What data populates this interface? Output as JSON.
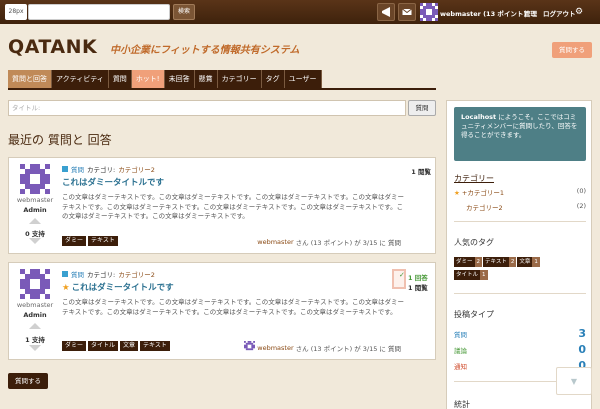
{
  "topbar": {
    "logo_text": "28px",
    "search_button": "検索",
    "user_label": "webmaster (13 ポイント)",
    "manage_label": "管理",
    "logout_label": "ログアウト",
    "settings_icon": "gear-icon"
  },
  "header": {
    "title": "QATANK",
    "tagline": "中小企業にフィットする情報共有システム",
    "ask_button": "質問する"
  },
  "nav": {
    "tabs": [
      "質問と回答",
      "アクティビティ",
      "質問",
      "ホット!",
      "未回答",
      "懸賞",
      "カテゴリー",
      "タグ",
      "ユーザー"
    ],
    "active_index": 0,
    "hot_index": 3
  },
  "search": {
    "placeholder": "タイトル:",
    "button": "質問"
  },
  "section": {
    "heading": "最近の 質問と 回答"
  },
  "questions": [
    {
      "author": "webmaster",
      "role": "Admin",
      "votes": "0 支持",
      "type": "質問",
      "category_prefix": "カテゴリ:",
      "category": "カテゴリー2",
      "title": "これはダミータイトルです",
      "starred": false,
      "body": "この文章はダミーテキストです。この文章はダミーテキストです。この文章はダミーテキストです。この文章はダミーテキストです。この文章はダミーテキストです。この文章はダミーテキストです。この文章はダミーテキストです。この文章はダミーテキストです。この文章はダミーテキストです。",
      "tags": [
        "ダミー",
        "テキスト"
      ],
      "answers": "1 閲覧",
      "footer_user": "webmaster",
      "footer_text": "さん (13 ポイント) が 3/15 に 質問"
    },
    {
      "author": "webmaster",
      "role": "Admin",
      "votes": "1 支持",
      "type": "質問",
      "category_prefix": "カテゴリ:",
      "category": "カテゴリー2",
      "title": "これはダミータイトルです",
      "starred": true,
      "body": "この文章はダミーテキストです。この文章はダミーテキストです。この文章はダミーテキストです。この文章はダミーテキストです。この文章はダミーテキストです。この文章はダミーテキストです。この文章はダミーテキストです。",
      "tags": [
        "ダミー",
        "タイトル",
        "文章",
        "テキスト"
      ],
      "answered_label": "1 回答",
      "views": "1 閲覧",
      "footer_user": "webmaster",
      "footer_text": "さん (13 ポイント) が 3/15 に 質問"
    }
  ],
  "ask_bottom": "質問する",
  "sidebar": {
    "welcome": "Localhost にようこそ。ここではコミュニティメンバーに質問したり、回答を得ることができます。",
    "welcome_bold": "Localhost",
    "categories_heading": "カテゴリー",
    "categories": [
      {
        "name": "+カテゴリー1",
        "count": "(0)",
        "starred": true
      },
      {
        "name": "カテゴリー2",
        "count": "(2)",
        "starred": false
      }
    ],
    "tags_heading": "人気のタグ",
    "tags": [
      {
        "name": "ダミー",
        "count": "2"
      },
      {
        "name": "テキスト",
        "count": "2"
      },
      {
        "name": "文章",
        "count": "1"
      },
      {
        "name": "タイトル",
        "count": "1"
      }
    ],
    "types_heading": "投稿タイプ",
    "types": [
      {
        "label": "質問",
        "value": "3",
        "color": "#2a80b8"
      },
      {
        "label": "議論",
        "value": "0",
        "color": "#4a9a3a"
      },
      {
        "label": "通知",
        "value": "0",
        "color": "#d04a2a"
      }
    ],
    "stats_heading": "統計"
  },
  "colors": {
    "brand": "#3c1e0a",
    "accent": "#f0a07a",
    "link": "#2a7090"
  }
}
